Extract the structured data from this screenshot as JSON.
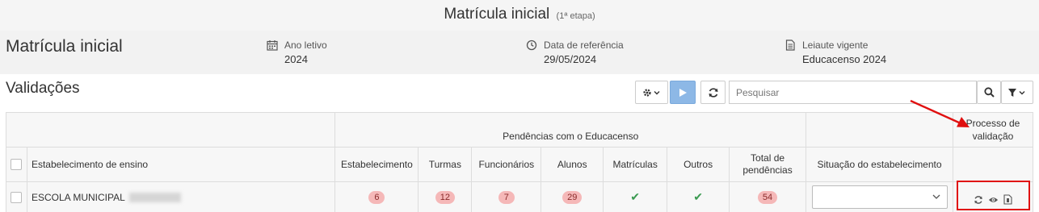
{
  "top": {
    "title": "Matrícula inicial",
    "subtitle": "(1ª etapa)"
  },
  "header": {
    "title": "Matrícula inicial",
    "info": [
      {
        "label": "Ano letivo",
        "value": "2024",
        "icon": "calendar-icon"
      },
      {
        "label": "Data de referência",
        "value": "29/05/2024",
        "icon": "clock-icon"
      },
      {
        "label": "Leiaute vigente",
        "value": "Educacenso 2024",
        "icon": "document-icon"
      }
    ]
  },
  "section": {
    "title": "Validações"
  },
  "toolbar": {
    "search_placeholder": "Pesquisar"
  },
  "table": {
    "group_header": "Pendências com o Educacenso",
    "process_header": "Processo de validação",
    "columns": {
      "school": "Estabelecimento de ensino",
      "estabelecimento": "Estabelecimento",
      "turmas": "Turmas",
      "funcionarios": "Funcionários",
      "alunos": "Alunos",
      "matriculas": "Matrículas",
      "outros": "Outros",
      "total": "Total de pendências",
      "situacao": "Situação do estabelecimento"
    },
    "rows": [
      {
        "school": "ESCOLA MUNICIPAL",
        "estabelecimento": "6",
        "turmas": "12",
        "funcionarios": "7",
        "alunos": "29",
        "matriculas": "ok",
        "outros": "ok",
        "total": "54",
        "situacao": ""
      }
    ]
  },
  "colors": {
    "badge_bg": "#f5b8b8",
    "check": "#3a9a50",
    "play_button": "#8db8e6",
    "annotation": "#e01010"
  }
}
